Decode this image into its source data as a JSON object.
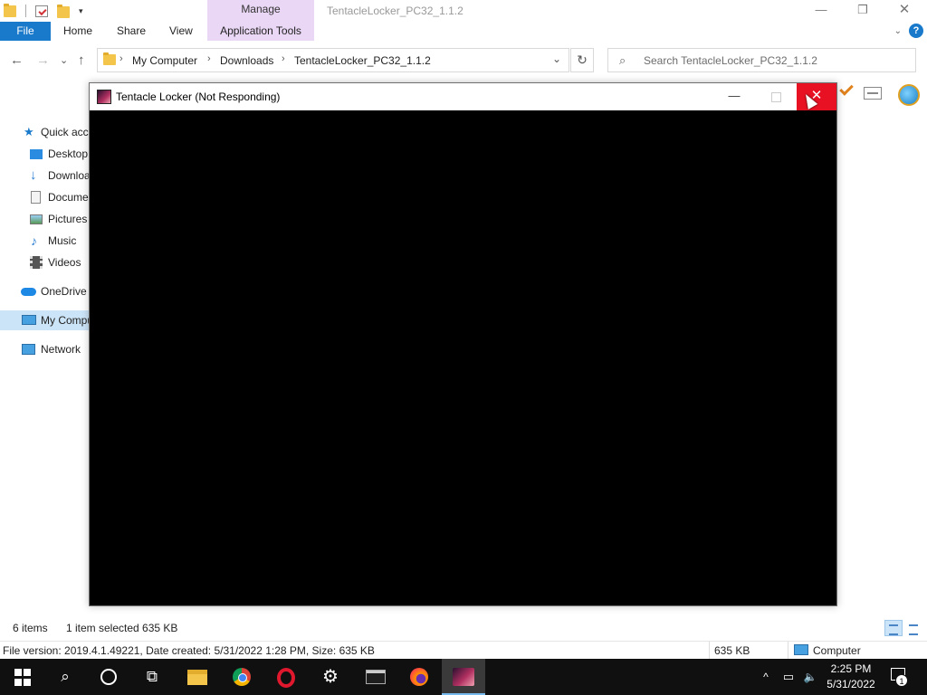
{
  "explorer": {
    "title": "TentacleLocker_PC32_1.1.2",
    "context_tab_group": "Manage",
    "window_controls": {
      "minimize": "—",
      "maximize": "❐",
      "close": "✕"
    }
  },
  "ribbon": {
    "tabs": [
      "File",
      "Home",
      "Share",
      "View",
      "Application Tools"
    ],
    "expand_glyph": "⌄",
    "help_glyph": "?"
  },
  "address_bar": {
    "back": "←",
    "forward": "→",
    "recent": "⌄",
    "up": "↑",
    "breadcrumbs": [
      "My Computer",
      "Downloads",
      "TentacleLocker_PC32_1.1.2"
    ],
    "separator": "›",
    "dropdown": "⌄",
    "refresh": "↻"
  },
  "search": {
    "placeholder": "Search TentacleLocker_PC32_1.1.2",
    "icon": "search-icon"
  },
  "sidebar": {
    "items": [
      {
        "label": "Quick access",
        "icon": "star-icon",
        "level": 0,
        "selected": false
      },
      {
        "label": "Desktop",
        "icon": "desktop-icon",
        "level": 1,
        "selected": false
      },
      {
        "label": "Downloads",
        "icon": "download-icon",
        "level": 1,
        "selected": false
      },
      {
        "label": "Documents",
        "icon": "document-icon",
        "level": 1,
        "selected": false
      },
      {
        "label": "Pictures",
        "icon": "pictures-icon",
        "level": 1,
        "selected": false
      },
      {
        "label": "Music",
        "icon": "music-icon",
        "level": 1,
        "selected": false
      },
      {
        "label": "Videos",
        "icon": "videos-icon",
        "level": 1,
        "selected": false
      },
      {
        "label": "OneDrive",
        "icon": "cloud-icon",
        "level": 0,
        "selected": false
      },
      {
        "label": "My Computer",
        "icon": "computer-icon",
        "level": 0,
        "selected": true
      },
      {
        "label": "Network",
        "icon": "network-icon",
        "level": 0,
        "selected": false
      }
    ]
  },
  "dialog": {
    "title": "Tentacle Locker (Not Responding)",
    "minimize": "—",
    "close": "✕",
    "colors": {
      "close_bg": "#e81123",
      "body_bg": "#000000"
    }
  },
  "status": {
    "item_count": "6 items",
    "selection": "1 item selected  635 KB",
    "details": "File version: 2019.4.1.49221, Date created: 5/31/2022 1:28 PM, Size: 635 KB",
    "size": "635 KB",
    "location": "Computer"
  },
  "taskbar": {
    "apps": [
      "start-icon",
      "search-icon",
      "cortana-icon",
      "task-view-icon",
      "file-explorer-icon",
      "chrome-icon",
      "opera-icon",
      "settings-icon",
      "command-prompt-icon",
      "firefox-icon",
      "tentacle-locker-icon"
    ],
    "glyphs": {
      "search": "⌕",
      "taskview": "⧉",
      "settings": "⚙",
      "tray_chevron": "^",
      "network": "▭",
      "volume": "🔈",
      "notifications": "1"
    },
    "time": "2:25 PM",
    "date": "5/31/2022"
  },
  "colors": {
    "accent": "#1979ca",
    "context_tab": "#ead7f5",
    "selected_row": "#cce4f7",
    "taskbar": "#101010"
  }
}
